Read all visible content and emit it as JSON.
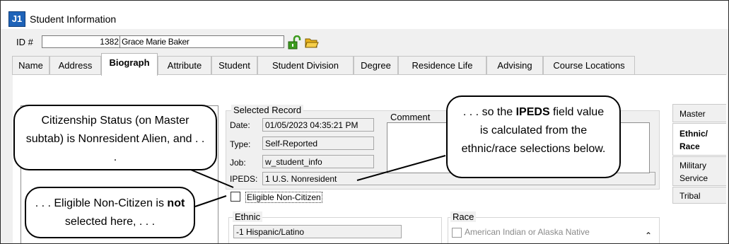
{
  "window": {
    "app_icon": "J1",
    "title": "Student Information"
  },
  "id_row": {
    "id_label": "ID #",
    "id_value": "1382",
    "name": "Grace Marie Baker",
    "icons": [
      "unlock-icon",
      "folder-open-icon"
    ]
  },
  "tabs": [
    {
      "label": "Name"
    },
    {
      "label": "Address"
    },
    {
      "label": "Biograph",
      "active": true
    },
    {
      "label": "Attribute"
    },
    {
      "label": "Student"
    },
    {
      "label": "Student Division"
    },
    {
      "label": "Degree"
    },
    {
      "label": "Residence Life"
    },
    {
      "label": "Advising"
    },
    {
      "label": "Course Locations"
    }
  ],
  "subtabs": [
    {
      "label": "Master"
    },
    {
      "label": "Ethnic/\nRace",
      "active": true
    },
    {
      "label": "Military\nService"
    },
    {
      "label": "Tribal"
    }
  ],
  "selected_record": {
    "title": "Selected Record",
    "date_label": "Date:",
    "date_value": "01/05/2023 04:35:21 PM",
    "type_label": "Type:",
    "type_value": "Self-Reported",
    "job_label": "Job:",
    "job_value": "w_student_info",
    "ipeds_label": "IPEDS:",
    "ipeds_value": "1  U.S. Nonresident",
    "comment_label": "Comment",
    "comment_value": ""
  },
  "eligible_non_citizen": {
    "label": "Eligible Non-Citizen",
    "checked": false
  },
  "ethnic": {
    "title": "Ethnic",
    "value": "-1  Hispanic/Latino"
  },
  "race": {
    "title": "Race",
    "items": [
      {
        "label": "American Indian or Alaska Native",
        "checked": false
      }
    ]
  },
  "callouts": {
    "citizenship": "Citizenship Status (on Master subtab) is Nonresident Alien, and . . .",
    "ipeds_pre": ". . . so the ",
    "ipeds_bold": "IPEDS",
    "ipeds_post": " field value is calculated from the ethnic/race selections below.",
    "eligible_pre": ". . . Eligible Non-Citizen is ",
    "eligible_bold": "not",
    "eligible_post": " selected here, . . ."
  },
  "colors": {
    "title_icon": "#1e63b8",
    "lock": "#3c9b1e",
    "folder": "#e9b21a",
    "window_bg": "#f0f0f0"
  }
}
